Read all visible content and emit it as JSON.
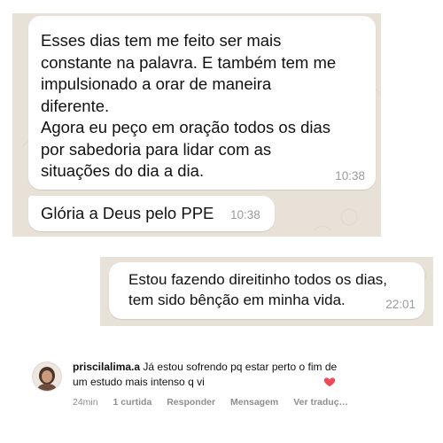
{
  "screenshot_1": {
    "messages": [
      {
        "text": "Esses dias tem me feito ser mais\nconstante na palavra. E também tem me\nimpulsionado a orar de maneira\ndiferente.\nAgora eu peço em oração todos os dias\npor sabedoria para lidar com as\nsituações do dia a dia.",
        "time": "10:38"
      },
      {
        "text": "Glória a Deus pelo PPE",
        "time": "10:38"
      }
    ]
  },
  "screenshot_2": {
    "message": {
      "text": "Estou fazendo direitinho todos os dias,\ntem sido bênção em minha vida.",
      "time": "22:01"
    }
  },
  "comment": {
    "username": "priscilalima.a",
    "text": "Já estou sofrendo pq estar perto o fim de um estudo mais intenso q vi",
    "time_ago": "24min",
    "likes": "1 curtida",
    "reply_label": "Responder",
    "message_label": "Mensagem",
    "translate_label": "Ver traduç…",
    "heart_color": "#ed4956"
  },
  "colors": {
    "chat_background": "#e8e1d7",
    "bubble": "#ffffff",
    "timestamp": "#9b9b9b"
  }
}
